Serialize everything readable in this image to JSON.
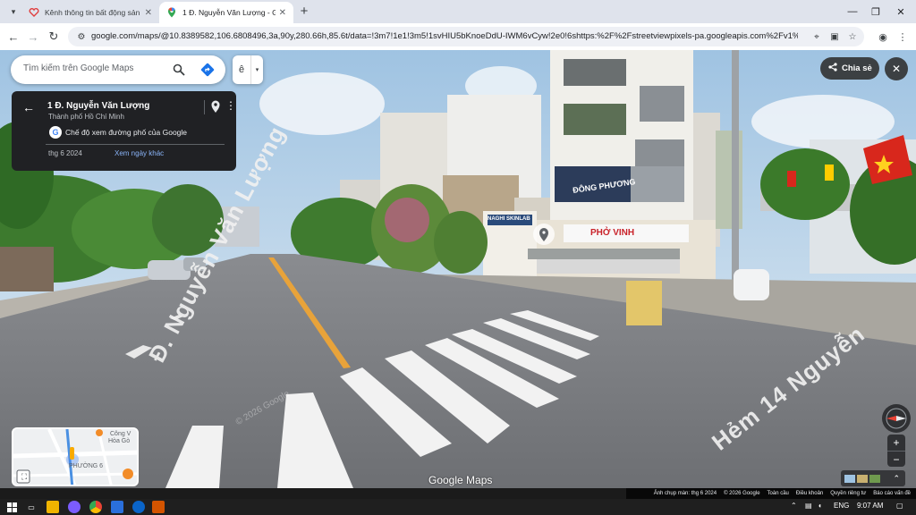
{
  "browser": {
    "tabs": [
      {
        "title": "Kênh thông tin bất động sản - ",
        "active": false
      },
      {
        "title": "1 Đ. Nguyễn Văn Lượng - Goog",
        "active": true
      }
    ],
    "new_tab": "+",
    "url": "google.com/maps/@10.8389582,106.6808496,3a,90y,280.66h,85.6t/data=!3m7!1e1!3m5!1svHIU5bKnoeDdU-IWM6vCyw!2e0!6shttps:%2F%2Fstreetviewpixels-pa.googleapis.com%2Fv1%2Fthumbnail%3"
  },
  "search": {
    "placeholder": "Tìm kiếm trên Google Maps"
  },
  "layer_button": {
    "label": "ê",
    "dropdown": "▾"
  },
  "info_card": {
    "title": "1 Đ. Nguyễn Văn Lượng",
    "subtitle": "Thành phố Hồ Chí Minh",
    "mode": "Chế độ xem đường phố của Google",
    "date": "thg 6 2024",
    "other_dates_link": "Xem ngày khác"
  },
  "share_button": {
    "label": "Chia sẻ"
  },
  "scene": {
    "shop_sign_1": "ĐÔNG PHƯƠNG",
    "shop_sign_2": "PHỞ VINH",
    "shop_sign_3": "NAGHI SKINLAB",
    "street_label_1": "Đ. Nguyễn Văn Lượng",
    "street_label_2": "Hẻm 14 Nguyễn",
    "street_watermark": "© 2026 Google"
  },
  "minimap": {
    "labels": [
      "Công V",
      "Hòa Gò",
      "PHƯỜNG 6"
    ]
  },
  "watermark": "Google Maps",
  "attribution": [
    "Ảnh chụp màn: thg 6 2024",
    "© 2026 Google",
    "Toàn cầu",
    "Điều khoản",
    "Quyền riêng tư",
    "Báo cáo vấn đề"
  ],
  "taskbar": {
    "lang": "ENG",
    "time": "9:07 AM"
  },
  "colors": {
    "road_line": "#e8a33a",
    "dark_panel": "#202124",
    "link": "#8ab4f8"
  }
}
